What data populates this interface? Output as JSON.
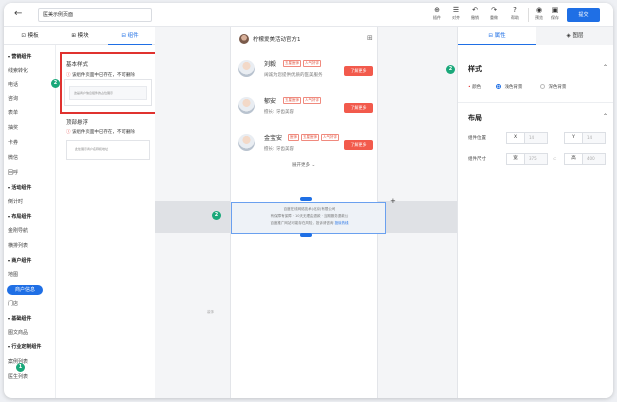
{
  "topbar": {
    "back_icon": "arrow-left-icon",
    "page_title": "医美示例页面",
    "buttons": [
      {
        "icon": "⊕",
        "label": "插件"
      },
      {
        "icon": "☰",
        "label": "对齐"
      },
      {
        "icon": "↶",
        "label": "撤销"
      },
      {
        "icon": "↷",
        "label": "重做"
      },
      {
        "icon": "?",
        "label": "帮助"
      },
      {
        "icon": "◉",
        "label": "预览"
      },
      {
        "icon": "▣",
        "label": "保存"
      }
    ],
    "submit_label": "提交"
  },
  "left_tabs": [
    {
      "icon": "⊡",
      "label": "模板"
    },
    {
      "icon": "⊞",
      "label": "模块"
    },
    {
      "icon": "⊟",
      "label": "组件"
    }
  ],
  "categories": [
    {
      "label": "营销组件",
      "head": true
    },
    {
      "label": "线索转化",
      "head": false
    },
    {
      "label": "电话",
      "head": false
    },
    {
      "label": "咨询",
      "head": false
    },
    {
      "label": "表单",
      "head": false
    },
    {
      "label": "抽奖",
      "head": false
    },
    {
      "label": "卡券",
      "head": false
    },
    {
      "label": "微信",
      "head": false
    },
    {
      "label": "回呼",
      "head": false
    },
    {
      "label": "活动组件",
      "head": true
    },
    {
      "label": "倒计时",
      "head": false
    },
    {
      "label": "布局组件",
      "head": true
    },
    {
      "label": "金刚导航",
      "head": false
    },
    {
      "label": "横排列表",
      "head": false
    },
    {
      "label": "商户组件",
      "head": true
    },
    {
      "label": "地图",
      "head": false
    },
    {
      "label": "商户信息",
      "head": false,
      "active": true
    },
    {
      "label": "门店",
      "head": false
    },
    {
      "label": "基础组件",
      "head": true
    },
    {
      "label": "图文商品",
      "head": false
    },
    {
      "label": "行业定制组件",
      "head": true
    },
    {
      "label": "案例列表",
      "head": false
    },
    {
      "label": "医生列表",
      "head": false
    }
  ],
  "component_panel": {
    "basic_label": "基本样式",
    "basic_warning": "该组件页面中已存在，不可删除",
    "basic_preview_text": "这是商户信息组件的占位展示",
    "top_label": "顶部悬浮",
    "top_warning": "该组件页面中已存在，不可删除",
    "top_preview_text": "此处展示商户名称和地址"
  },
  "badges": [
    "2",
    "2",
    "2",
    "1"
  ],
  "phone": {
    "header_title": "柠檬爱美活动官方1",
    "grid_icon": "grid-icon",
    "doctors": [
      {
        "name": "刘毅",
        "tags": [
          "五星医师",
          "人气好评"
        ],
        "desc": "阔诚为您提供优质的医美服务",
        "button": "了解更多"
      },
      {
        "name": "郁安",
        "tags": [
          "五星医师",
          "人气好评"
        ],
        "desc": "擅长:  牙齿美容",
        "button": "了解更多"
      },
      {
        "name": "金宝安",
        "tags": [
          "医师",
          "五星医师",
          "人气好评"
        ],
        "desc": "擅长:  牙齿美容",
        "button": "了解更多"
      }
    ],
    "expand_label": "展开更多"
  },
  "footer_box": {
    "line1": "百度在线网络技术(北京)有限公司",
    "line2": "有保障有保障  · 10天无理由退款  · 当期服务退款公",
    "line3_text": "百度推广网站可能存在风险，投诉请咨询",
    "line3_link": "投诉热线"
  },
  "canvas_label": "装饰",
  "right_panel": {
    "tabs": [
      {
        "icon": "⊟",
        "label": "属性"
      },
      {
        "icon": "◈",
        "label": "图层"
      }
    ],
    "style_title": "样式",
    "color_label": "颜色",
    "color_options": [
      {
        "label": "浅色背景",
        "selected": true
      },
      {
        "label": "深色背景",
        "selected": false
      }
    ],
    "layout_title": "布局",
    "position_label": "组件位置",
    "size_label": "组件尺寸",
    "fields": {
      "x_label": "X",
      "x_value": "14",
      "y_label": "Y",
      "y_value": "14",
      "w_label": "宽",
      "w_value": "375",
      "h_label": "高",
      "h_value": "400"
    }
  },
  "colors": {
    "accent": "#1f6fe5",
    "danger": "#e0322f",
    "button_red": "#f25a4c",
    "badge_green": "#1aa87a"
  }
}
